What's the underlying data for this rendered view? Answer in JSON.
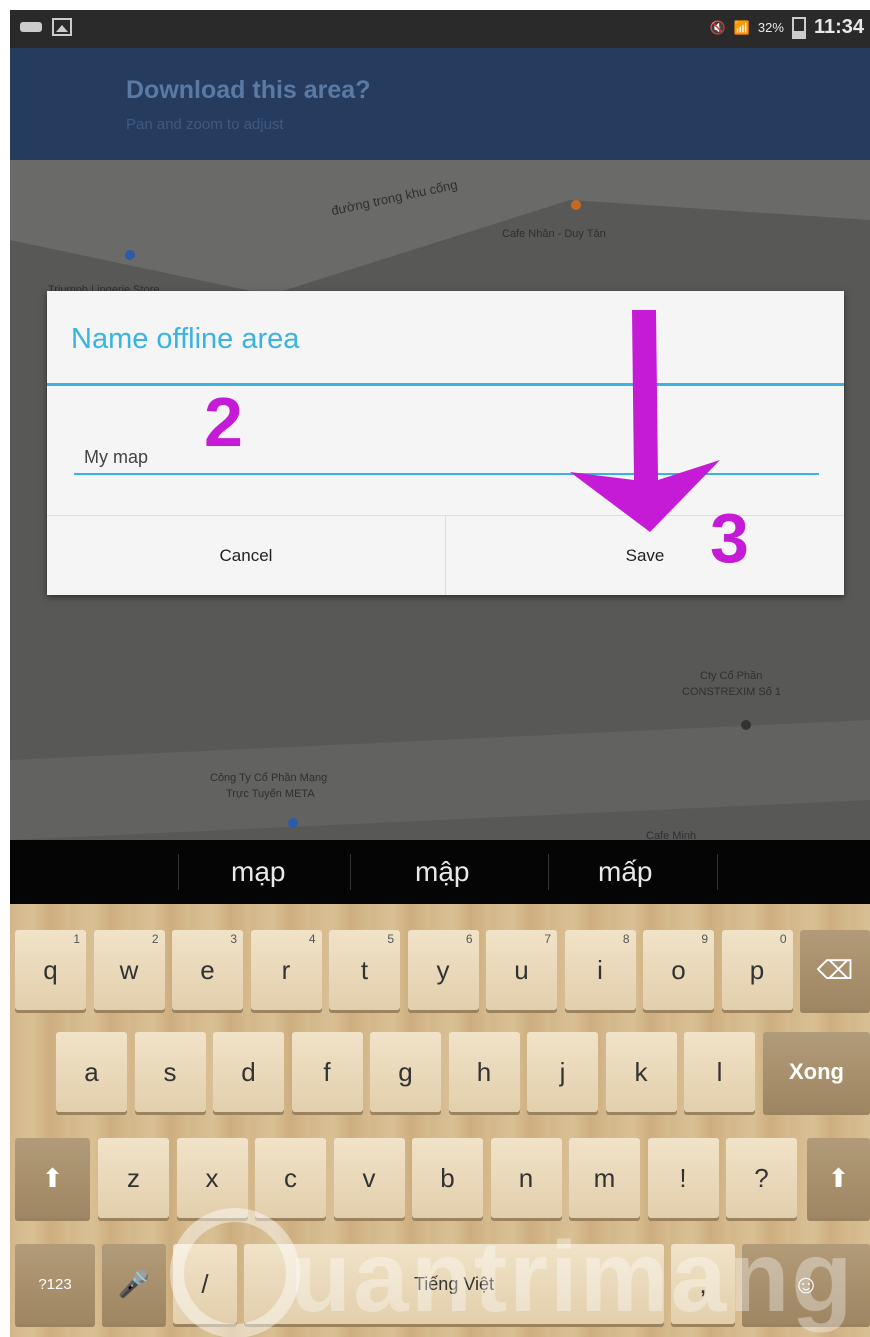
{
  "status_bar": {
    "battery": "32%",
    "time": "11:34",
    "icons": [
      "notification-icon",
      "image-icon",
      "mute-icon",
      "wifi-icon",
      "battery-icon"
    ]
  },
  "header": {
    "title": "Download this area?",
    "subtitle": "Pan and zoom to adjust"
  },
  "map": {
    "labels": [
      "đường trong khu cống",
      "Cafe Nhân - Duy Tân",
      "Triumph Lingerie Store",
      "Cty Cổ Phần",
      "CONSTREXIM Số 1",
      "Công Ty Cổ Phần Mạng",
      "Trực Tuyến META",
      "Cafe Minh"
    ]
  },
  "dialog": {
    "title": "Name offline area",
    "input_value": "My map",
    "cancel_label": "Cancel",
    "save_label": "Save"
  },
  "annotations": {
    "step2": "2",
    "step3": "3"
  },
  "suggestions": [
    "mạp",
    "mập",
    "mấp"
  ],
  "keyboard": {
    "row1": [
      {
        "k": "q",
        "h": "1"
      },
      {
        "k": "w",
        "h": "2"
      },
      {
        "k": "e",
        "h": "3"
      },
      {
        "k": "r",
        "h": "4"
      },
      {
        "k": "t",
        "h": "5"
      },
      {
        "k": "y",
        "h": "6"
      },
      {
        "k": "u",
        "h": "7"
      },
      {
        "k": "i",
        "h": "8"
      },
      {
        "k": "o",
        "h": "9"
      },
      {
        "k": "p",
        "h": "0"
      }
    ],
    "row2": [
      "a",
      "s",
      "d",
      "f",
      "g",
      "h",
      "j",
      "k",
      "l"
    ],
    "row3": [
      "z",
      "x",
      "c",
      "v",
      "b",
      "n",
      "m",
      "!",
      "?"
    ],
    "done_label": "Xong",
    "numbers_label": "?123",
    "space_label": "Tiếng Việt",
    "slash_label": "/",
    "comma_label": ","
  },
  "watermark": "uantrimang",
  "colors": {
    "accent": "#39b3e3",
    "annotation": "#c51ad6",
    "header_bg": "#263c5e"
  }
}
